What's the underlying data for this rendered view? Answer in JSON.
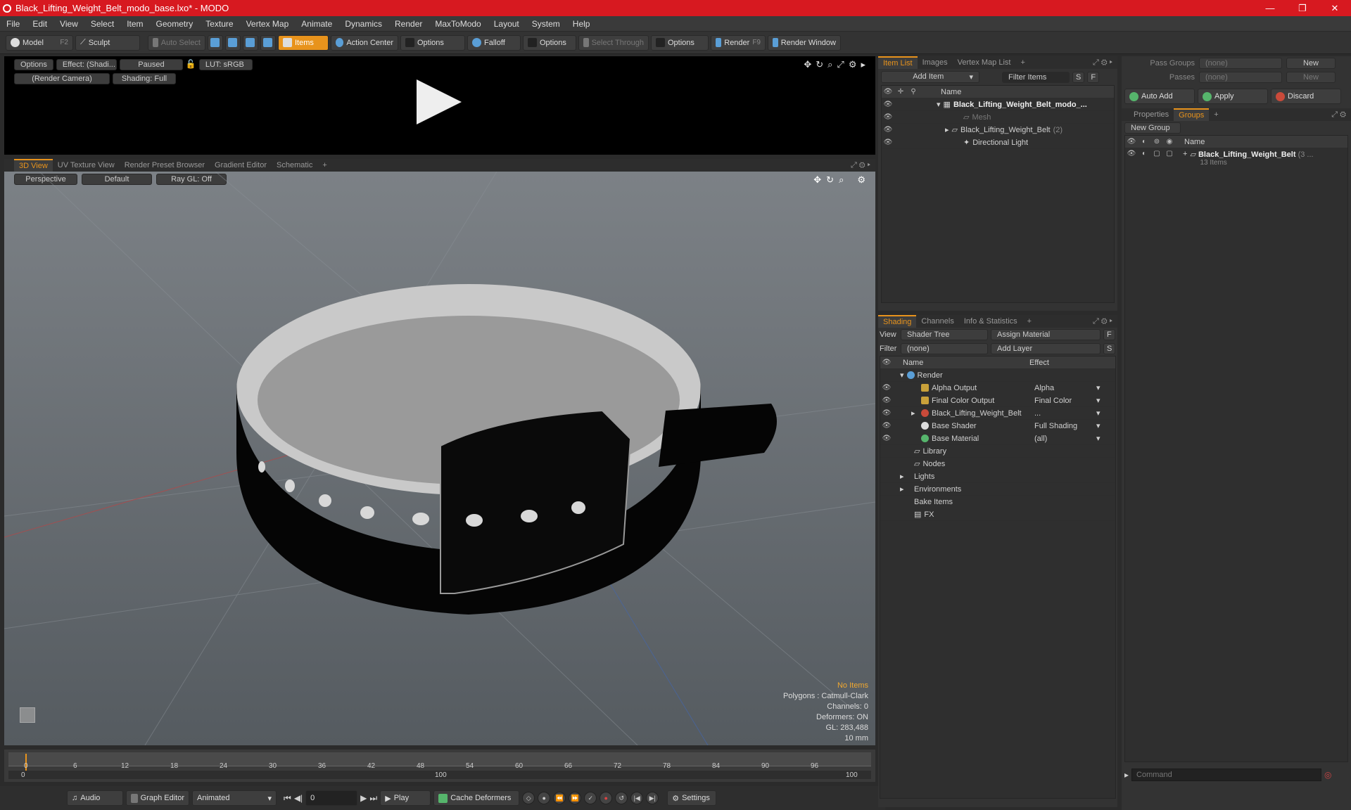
{
  "app": {
    "title": "Black_Lifting_Weight_Belt_modo_base.lxo* - MODO",
    "window_controls": [
      "—",
      "❐",
      "✕"
    ]
  },
  "menu": [
    "File",
    "Edit",
    "View",
    "Select",
    "Item",
    "Geometry",
    "Texture",
    "Vertex Map",
    "Animate",
    "Dynamics",
    "Render",
    "MaxToModo",
    "Layout",
    "System",
    "Help"
  ],
  "toolbar": {
    "model": "Model",
    "model_key": "F2",
    "sculpt": "Sculpt",
    "auto_select": "Auto Select",
    "items": "Items",
    "action_center": "Action Center",
    "options1": "Options",
    "falloff": "Falloff",
    "options2": "Options",
    "select_through": "Select Through",
    "options3": "Options",
    "render": "Render",
    "render_key": "F9",
    "render_window": "Render Window"
  },
  "preview": {
    "options": "Options",
    "effect": "Effect: (Shadi...",
    "paused": "Paused",
    "lut": "LUT: sRGB",
    "camera": "(Render Camera)",
    "shading": "Shading: Full"
  },
  "viewport_tabs": [
    "3D View",
    "UV Texture View",
    "Render Preset Browser",
    "Gradient Editor",
    "Schematic",
    "+"
  ],
  "viewport": {
    "perspective": "Perspective",
    "default": "Default",
    "raygl": "Ray GL: Off",
    "hud": {
      "no_items": "No Items",
      "polygons": "Polygons : Catmull-Clark",
      "channels": "Channels: 0",
      "deformers": "Deformers: ON",
      "gl": "GL: 283,488",
      "unit": "10 mm"
    }
  },
  "timeline": {
    "ticks": [
      "0",
      "6",
      "12",
      "18",
      "24",
      "30",
      "36",
      "42",
      "48",
      "54",
      "60",
      "66",
      "72",
      "78",
      "84",
      "90",
      "96"
    ],
    "range_start": "0",
    "range_mid": "100",
    "range_end": "100"
  },
  "bottombar": {
    "audio": "Audio",
    "graph_editor": "Graph Editor",
    "animated": "Animated",
    "frame": "0",
    "play": "Play",
    "cache_deformers": "Cache Deformers",
    "settings": "Settings"
  },
  "item_list": {
    "tabs": [
      "Item List",
      "Images",
      "Vertex Map List",
      "+"
    ],
    "add_item": "Add Item",
    "filter": "Filter Items",
    "s": "S",
    "f": "F",
    "col_name": "Name",
    "items": [
      {
        "label": "Black_Lifting_Weight_Belt_modo_...",
        "count": ""
      },
      {
        "label": "Mesh",
        "count": ""
      },
      {
        "label": "Black_Lifting_Weight_Belt",
        "count": "(2)"
      },
      {
        "label": "Directional Light",
        "count": ""
      }
    ]
  },
  "shading": {
    "tabs": [
      "Shading",
      "Channels",
      "Info & Statistics",
      "+"
    ],
    "view_label": "View",
    "view_value": "Shader Tree",
    "assign_material": "Assign Material",
    "f": "F",
    "filter_label": "Filter",
    "filter_value": "(none)",
    "add_layer": "Add Layer",
    "s": "S",
    "col_name": "Name",
    "col_effect": "Effect",
    "rows": [
      {
        "name": "Render",
        "effect": ""
      },
      {
        "name": "Alpha Output",
        "effect": "Alpha"
      },
      {
        "name": "Final Color Output",
        "effect": "Final Color"
      },
      {
        "name": "Black_Lifting_Weight_Belt",
        "effect": "..."
      },
      {
        "name": "Base Shader",
        "effect": "Full Shading"
      },
      {
        "name": "Base Material",
        "effect": "(all)"
      },
      {
        "name": "Library",
        "effect": ""
      },
      {
        "name": "Nodes",
        "effect": ""
      },
      {
        "name": "Lights",
        "effect": ""
      },
      {
        "name": "Environments",
        "effect": ""
      },
      {
        "name": "Bake Items",
        "effect": ""
      },
      {
        "name": "FX",
        "effect": ""
      }
    ]
  },
  "groups": {
    "pass_groups": "Pass Groups",
    "pass_groups_value": "(none)",
    "new": "New",
    "passes": "Passes",
    "passes_value": "(none)",
    "new2": "New",
    "auto_add": "Auto Add",
    "apply": "Apply",
    "discard": "Discard",
    "tabs": [
      "Properties",
      "Groups",
      "+"
    ],
    "new_group": "New Group",
    "col_name": "Name",
    "group_name": "Black_Lifting_Weight_Belt",
    "group_suffix": "(3 ...",
    "group_count": "13 Items",
    "command_placeholder": "Command"
  }
}
